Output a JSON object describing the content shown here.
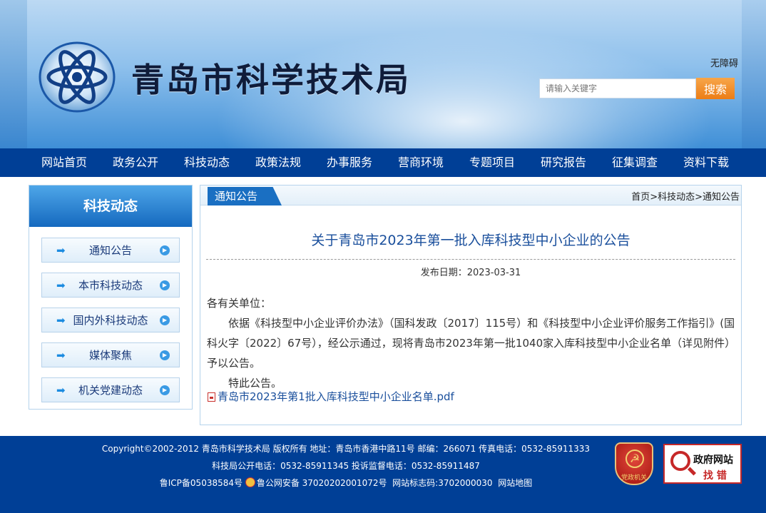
{
  "header": {
    "site_title": "青岛市科学技术局",
    "accessibility_link": "无障碍",
    "search": {
      "placeholder": "请输入关键字",
      "button": "搜索"
    }
  },
  "nav": {
    "items": [
      "网站首页",
      "政务公开",
      "科技动态",
      "政策法规",
      "办事服务",
      "营商环境",
      "专题项目",
      "研究报告",
      "征集调查",
      "资料下载"
    ]
  },
  "sidebar": {
    "title": "科技动态",
    "items": [
      "通知公告",
      "本市科技动态",
      "国内外科技动态",
      "媒体聚焦",
      "机关党建动态"
    ]
  },
  "content": {
    "tab": "通知公告",
    "breadcrumb": "首页>科技动态>通知公告",
    "title": "关于青岛市2023年第一批入库科技型中小企业的公告",
    "publish_date": "发布日期：2023-03-31",
    "salutation": "各有关单位：",
    "paragraph": "依据《科技型中小企业评价办法》（国科发政〔2017〕115号）和《科技型中小企业评价服务工作指引》(国科火字〔2022〕67号），经公示通过，现将青岛市2023年第一批1040家入库科技型中小企业名单（详见附件）予以公告。",
    "closing": "特此公告。",
    "attachment": "青岛市2023年第1批入库科技型中小企业名单.pdf"
  },
  "footer": {
    "line1": "Copyright©2002-2012 青岛市科学技术局 版权所有 地址：青岛市香港中路11号 邮编：266071 传真电话：0532-85911333",
    "line2": "科技局公开电话：0532-85911345 投诉监督电话：0532-85911487",
    "icp": "鲁ICP备05038584号",
    "police": "鲁公网安备 37020202001072号",
    "site_code": "网站标志码:3702000030",
    "sitemap": "网站地图",
    "party_badge": "党政机关",
    "error_title": "政府网站",
    "error_sub": "找 错"
  }
}
